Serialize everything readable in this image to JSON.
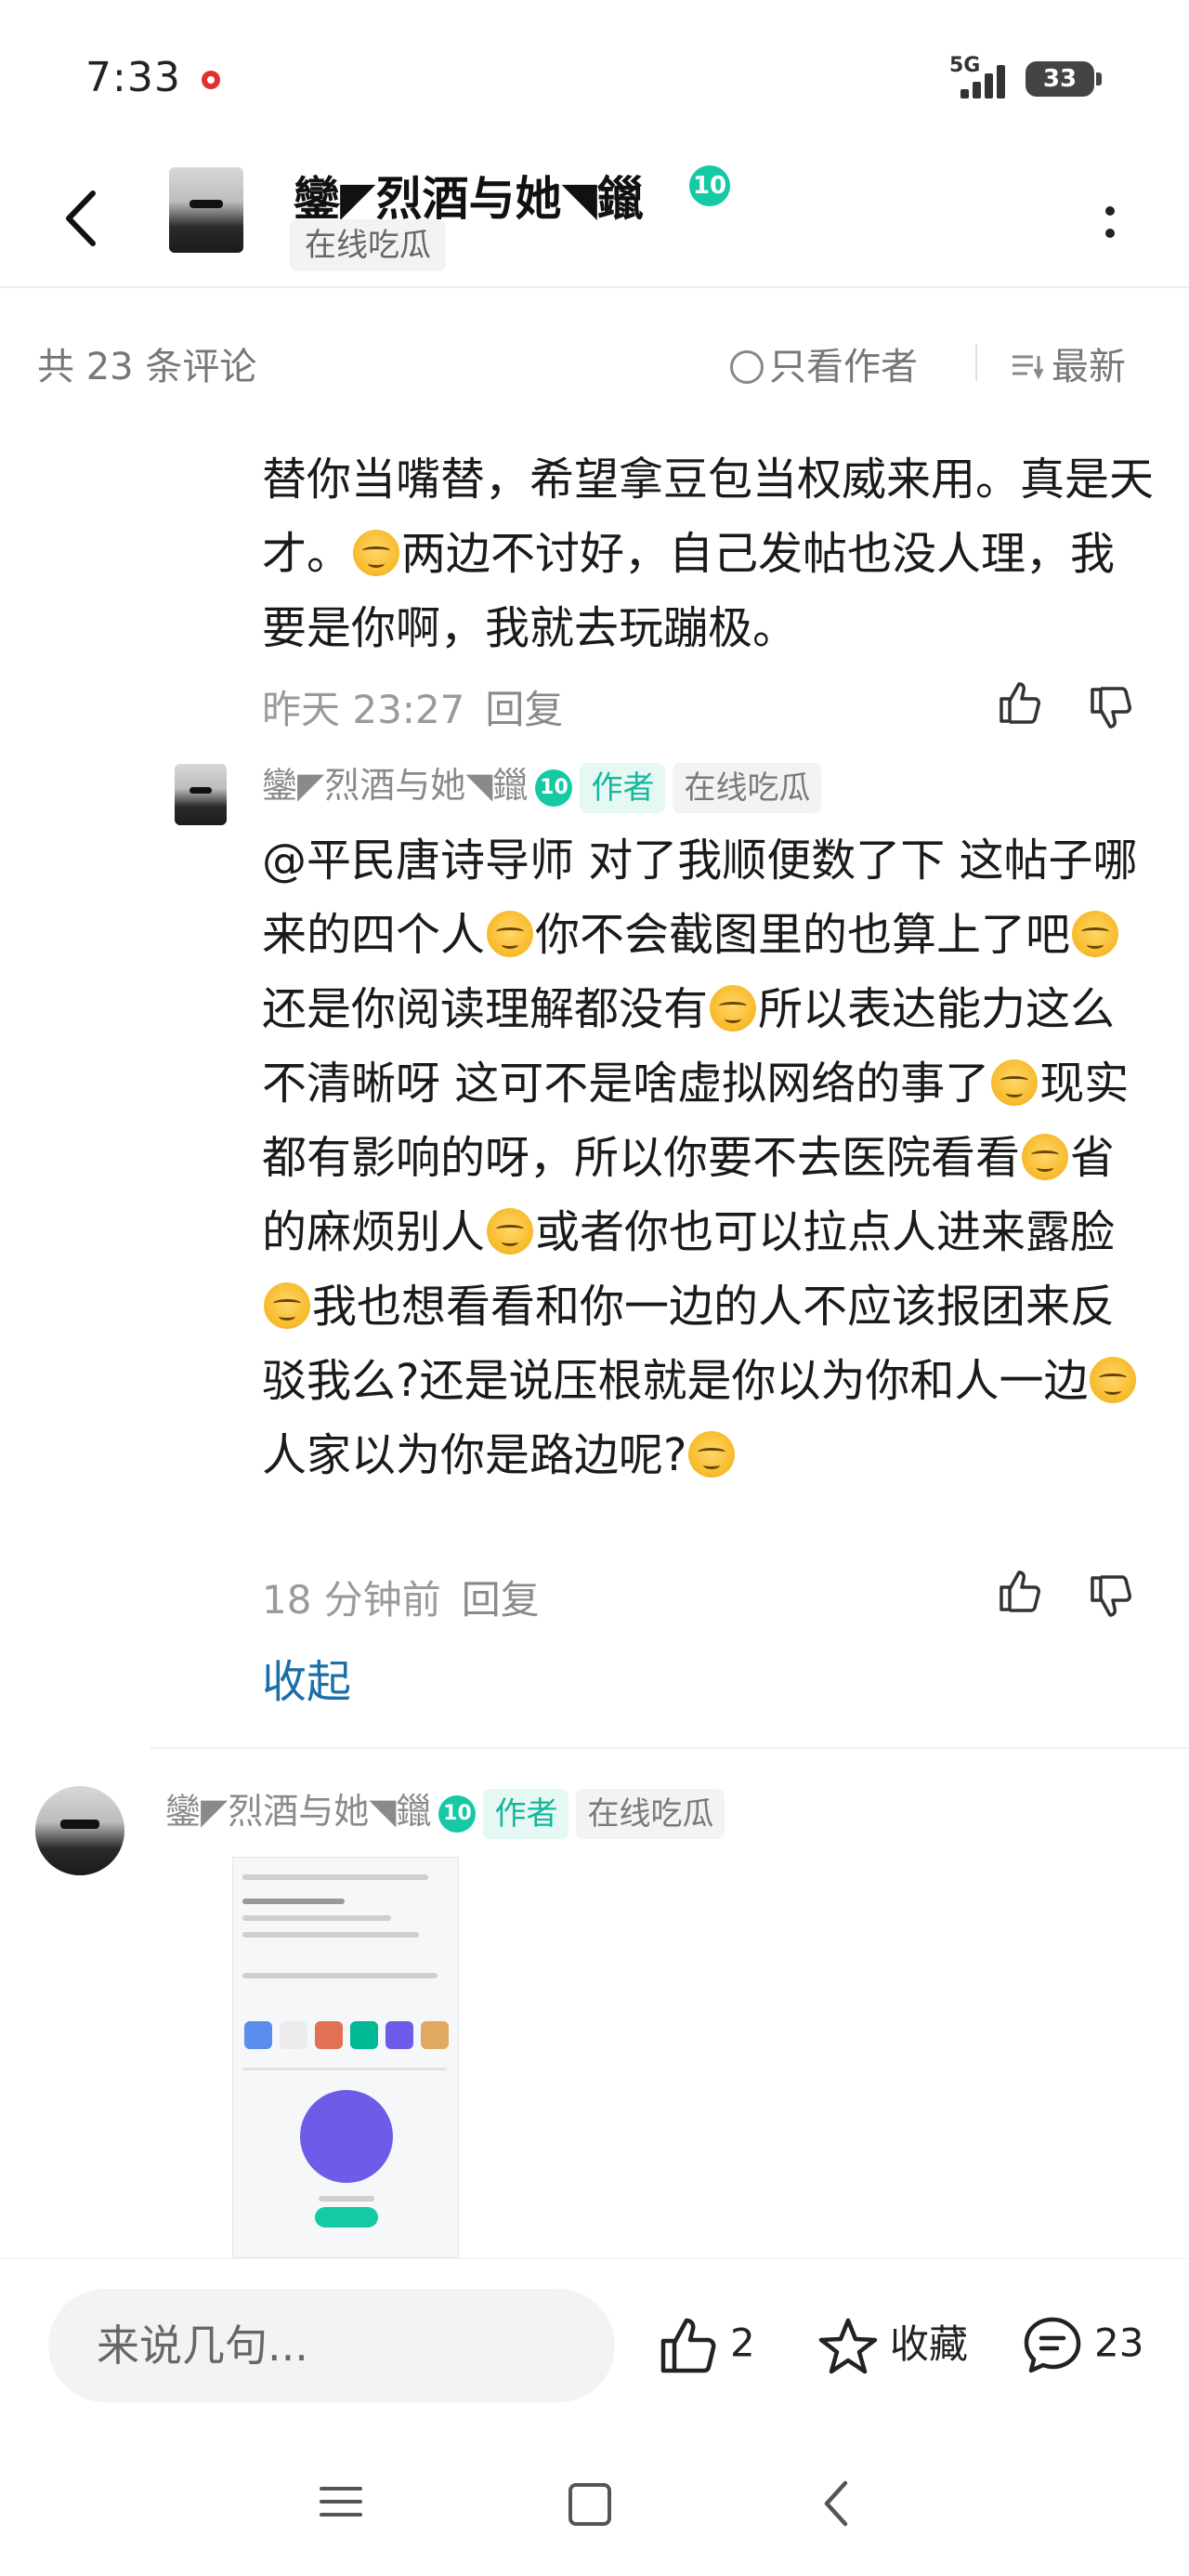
{
  "status_bar": {
    "time": "7:33",
    "network": "5G",
    "battery": "33"
  },
  "header": {
    "username": "鑾◤烈酒与她◥鑞",
    "level": "10",
    "tag": "在线吃瓜"
  },
  "comment_bar": {
    "count_label": "共 23 条评论",
    "author_only_label": "只看作者",
    "sort_label": "最新"
  },
  "comments": {
    "prev_reply": {
      "text": "替你当嘴替，希望拿豆包当权威来用。真是天才。",
      "text_tail": "两边不讨好，自己发帖也没人理，我要是你啊，我就去玩蹦极。",
      "time": "昨天 23:27",
      "reply_label": "回复"
    },
    "author_reply": {
      "username": "鑾◤烈酒与她◥鑞",
      "level": "10",
      "author_tag": "作者",
      "status_tag": "在线吃瓜",
      "segments": [
        "@平民唐诗导师  对了我顺便数了下  这帖子哪来的四个人",
        "你不会截图里的也算上了吧",
        "还是你阅读理解都没有",
        "所以表达能力这么不清晰呀  这可不是啥虚拟网络的事了",
        "现实都有影响的呀，所以你要不去医院看看",
        "省的麻烦别人",
        "或者你也可以拉点人进来露脸",
        "我也想看看和你一边的人不应该报团来反驳我么?还是说压根就是你以为你和人一边",
        "人家以为你是路边呢?"
      ],
      "time": "18 分钟前",
      "reply_label": "回复"
    },
    "collapse_label": "收起",
    "next_comment": {
      "username": "鑾◤烈酒与她◥鑞",
      "level": "10",
      "author_tag": "作者",
      "status_tag": "在线吃瓜"
    }
  },
  "bottom_bar": {
    "input_placeholder": "来说几句...",
    "like_count": "2",
    "favorite_label": "收藏",
    "comment_count": "23"
  }
}
